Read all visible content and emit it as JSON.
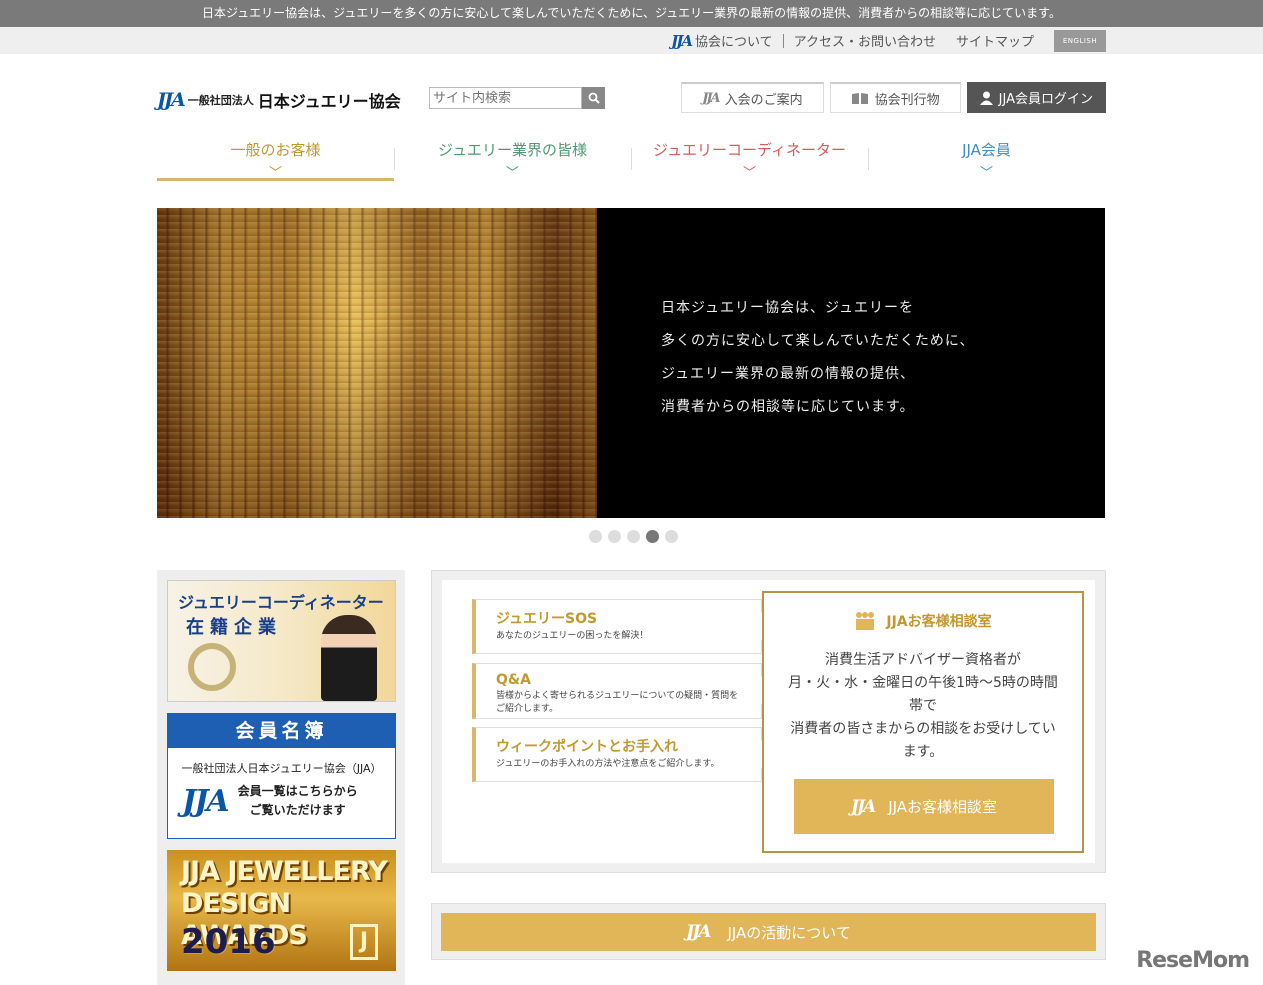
{
  "topbar": {
    "text": "日本ジュエリー協会は、ジュエリーを多くの方に安心して楽しんでいただくために、ジュエリー業界の最新の情報の提供、消費者からの相談等に応じています。"
  },
  "util": {
    "about": "協会について",
    "access": "アクセス・お問い合わせ",
    "sitemap": "サイトマップ",
    "english": "ENGLISH"
  },
  "logo": {
    "mark": "JJA",
    "sub": "一般社団法人",
    "name": "日本ジュエリー協会"
  },
  "search": {
    "placeholder": "サイト内検索"
  },
  "header_buttons": {
    "join": "入会のご案内",
    "publications": "協会刊行物",
    "login": "JJA会員ログイン"
  },
  "nav": [
    {
      "label": "一般のお客様",
      "color": "#c3982e"
    },
    {
      "label": "ジュエリー業界の皆様",
      "color": "#4f9a73"
    },
    {
      "label": "ジュエリーコーディネーター",
      "color": "#d9595c"
    },
    {
      "label": "JJA会員",
      "color": "#3f8fc7"
    }
  ],
  "hero": {
    "lines": [
      "日本ジュエリー協会は、ジュエリーを",
      "多くの方に安心して楽しんでいただくために、",
      "ジュエリー業界の最新の情報の提供、",
      "消費者からの相談等に応じています。"
    ]
  },
  "slider": {
    "count": 5,
    "active": 4
  },
  "sidebar": {
    "coordinator": {
      "line1": "ジュエリーコーディネーター",
      "line2": "在籍企業"
    },
    "members": {
      "title": "会員名簿",
      "org": "一般社団法人日本ジュエリー協会（JJA）",
      "msg1": "会員一覧はこちらから",
      "msg2": "ご覧いただけます"
    },
    "awards": {
      "line1": "JJA JEWELLERY",
      "line2": "DESIGN AWARDS",
      "year": "2016",
      "mark": "J"
    }
  },
  "links": [
    {
      "title": "ジュエリーSOS",
      "desc": "あなたのジュエリーの困ったを解決！"
    },
    {
      "title": "Q&A",
      "desc": "皆様からよく寄せられるジュエリーについての疑問・質問をご紹介します。"
    },
    {
      "title": "ウィークポイントとお手入れ",
      "desc": "ジュエリーのお手入れの方法や注意点をご紹介します。"
    }
  ],
  "consult": {
    "title": "JJAお客様相談室",
    "body": [
      "消費生活アドバイザー資格者が",
      "月・火・水・金曜日の午後1時～5時の時間帯で",
      "消費者の皆さまからの相談をお受けしています。"
    ],
    "button": "JJAお客様相談室"
  },
  "activities": {
    "button": "JJAの活動について"
  },
  "watermark": "ReseMom",
  "colors": {
    "gold": "#e1b658",
    "blue": "#1f5fb3"
  }
}
